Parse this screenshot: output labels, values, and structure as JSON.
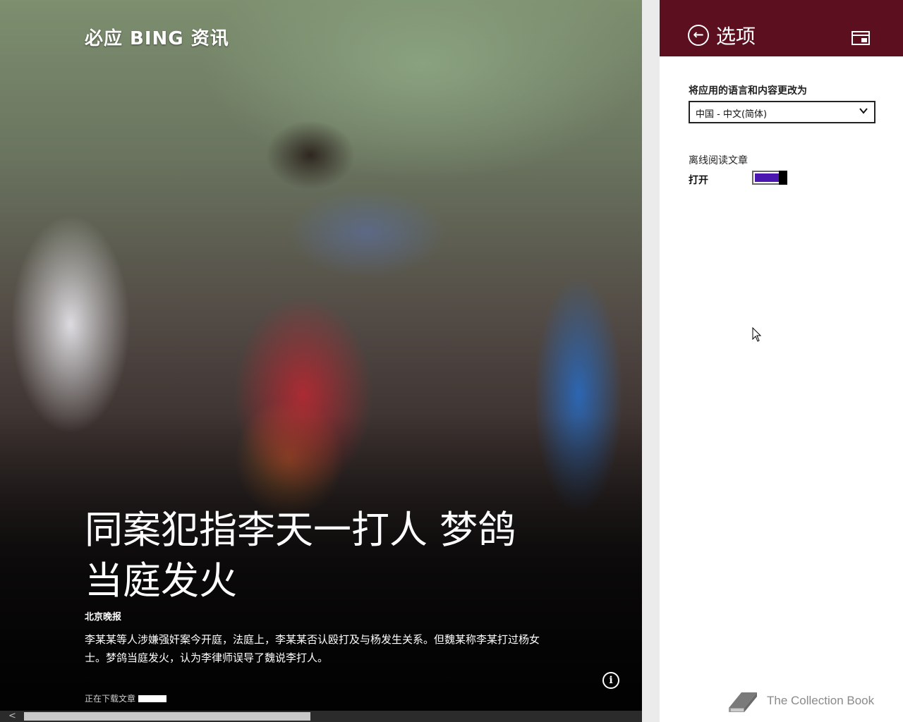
{
  "app": {
    "title": "必应 BING 资讯"
  },
  "article": {
    "headline": "同案犯指李天一打人 梦鸽当庭发火",
    "source": "北京晚报",
    "summary": "李某某等人涉嫌强奸案今开庭，法庭上，李某某否认殴打及与杨发生关系。但魏某称李某打过杨女士。梦鸽当庭发火，认为李律师误导了魏说李打人。",
    "download_status": "正在下载文章"
  },
  "settings": {
    "title": "选项",
    "language_label": "将应用的语言和内容更改为",
    "language_value": "中国 - 中文(简体)",
    "offline_label": "离线阅读文章",
    "offline_state": "打开",
    "offline_on": true
  },
  "watermark": {
    "text": "The Collection Book"
  },
  "colors": {
    "header": "#5c0f1f",
    "toggle_fill": "#4a17b0"
  },
  "icons": [
    "back-arrow-icon",
    "app-window-icon",
    "chevron-down-icon",
    "info-icon",
    "book-icon",
    "mouse-cursor-icon"
  ]
}
